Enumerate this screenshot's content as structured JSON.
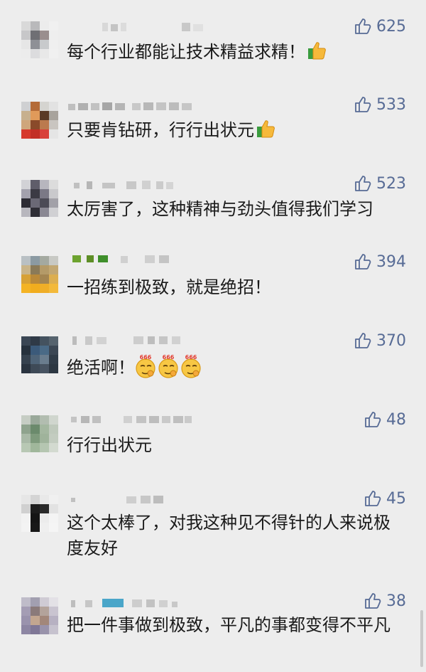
{
  "comments": [
    {
      "likes": "625",
      "text": "每个行业都能让技术精益求精！",
      "emoji": "thumbs-up"
    },
    {
      "likes": "533",
      "text": "只要肯钻研，行行出状元",
      "emoji": "thumbs-up"
    },
    {
      "likes": "523",
      "text": "太厉害了，这种精神与劲头值得我们学习",
      "emoji": ""
    },
    {
      "likes": "394",
      "text": "一招练到极致，就是绝招！",
      "emoji": ""
    },
    {
      "likes": "370",
      "text": "绝活啊！",
      "emoji": "666-face",
      "emoji_label": "666"
    },
    {
      "likes": "48",
      "text": "行行出状元",
      "emoji": ""
    },
    {
      "likes": "45",
      "text": "这个太棒了，对我这种见不得针的人来说极度友好",
      "emoji": ""
    },
    {
      "likes": "38",
      "text": "把一件事做到极致，平凡的事都变得不平凡",
      "emoji": ""
    }
  ],
  "icons": {
    "like": "thumbs-up-outline-icon"
  },
  "colors": {
    "background": "#ededed",
    "likes": "#576b95",
    "text": "#1a1a1a"
  }
}
